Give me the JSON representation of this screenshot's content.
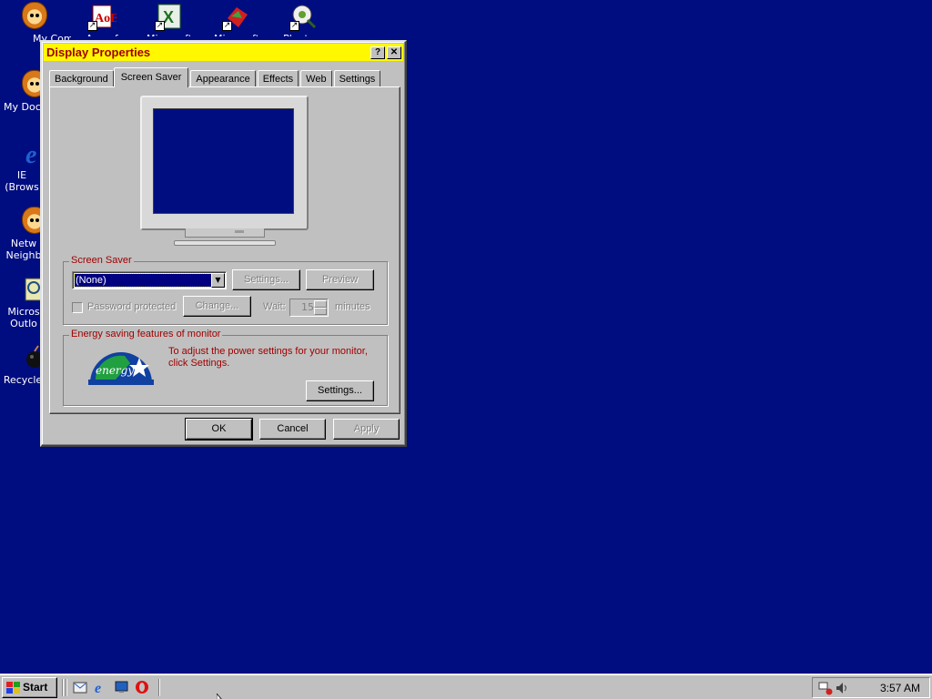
{
  "desktop": {
    "icons": [
      {
        "label": "My Comp",
        "icon": "my-computer-icon"
      },
      {
        "label": "Age of",
        "icon": "age-of-empires-icon",
        "shortcut": true
      },
      {
        "label": "Microsoft",
        "icon": "excel-icon",
        "shortcut": true
      },
      {
        "label": "Microsoft",
        "icon": "microsoft-app-icon",
        "shortcut": true
      },
      {
        "label": "Plantsvs",
        "icon": "plants-icon",
        "shortcut": true
      },
      {
        "label": "My Docum",
        "icon": "my-documents-icon"
      },
      {
        "label": "IE (Brows",
        "icon": "ie-browser-icon"
      },
      {
        "label": "Netw Neighb",
        "icon": "network-neighborhood-icon"
      },
      {
        "label": "Micros Outlo",
        "icon": "outlook-icon"
      },
      {
        "label": "Recycle",
        "icon": "recycle-bin-icon"
      }
    ],
    "background_color": "#000d80"
  },
  "window": {
    "title": "Display Properties",
    "help_glyph": "?",
    "close_glyph": "✕",
    "titlebar_color": "#fff800",
    "title_color": "#a00000",
    "tabs": [
      {
        "label": "Background",
        "active": false
      },
      {
        "label": "Screen Saver",
        "active": true
      },
      {
        "label": "Appearance",
        "active": false
      },
      {
        "label": "Effects",
        "active": false
      },
      {
        "label": "Web",
        "active": false
      },
      {
        "label": "Settings",
        "active": false
      }
    ],
    "screensaver": {
      "group_label": "Screen Saver",
      "selected": "(None)",
      "settings_button": "Settings...",
      "preview_button": "Preview",
      "password_label": "Password protected",
      "change_button": "Change...",
      "wait_label": "Wait:",
      "wait_value": "15",
      "minutes_label": "minutes"
    },
    "energy": {
      "group_label": "Energy saving features of monitor",
      "description": "To adjust the power settings for your monitor, click Settings.",
      "settings_button": "Settings...",
      "logo_text": "energy"
    },
    "buttons": {
      "ok": "OK",
      "cancel": "Cancel",
      "apply": "Apply"
    }
  },
  "taskbar": {
    "start_label": "Start",
    "quick_launch": [
      "outlook-express-icon",
      "ie-icon",
      "show-desktop-icon",
      "opera-icon"
    ],
    "tray_icons": [
      "network-tray-icon",
      "volume-tray-icon"
    ],
    "clock": "3:57 AM"
  }
}
